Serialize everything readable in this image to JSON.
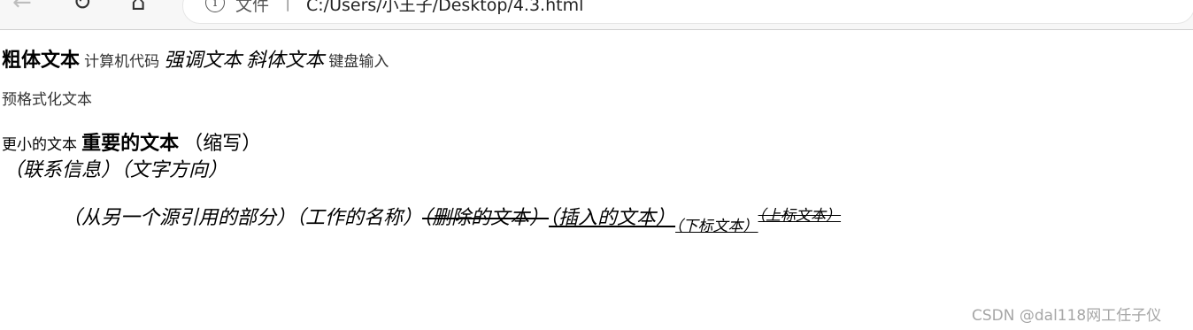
{
  "browser": {
    "address_label": "文件",
    "separator": "|",
    "url": "C:/Users/小王子/Desktop/4.3.html"
  },
  "page": {
    "bold_text": "粗体文本",
    "computer_code": "计算机代码",
    "emphasized_text": "强调文本",
    "italic_text": "斜体文本",
    "keyboard_input": "键盘输入",
    "preformatted_text": "预格式化文本",
    "smaller_text": "更小的文本",
    "important_text": "重要的文本",
    "abbreviation": "（缩写）",
    "contact_info": "（联系信息）",
    "text_direction": "（文字方向）",
    "quote_source": "（从另一个源引用的部分）",
    "work_title": "（工作的名称）",
    "deleted_text": "（删除的文本）",
    "inserted_text": "（插入的文本）",
    "subscript_text": "（下标文本）",
    "superscript_text": "（上标文本）"
  },
  "watermark": "CSDN @dal118网工任子仪"
}
